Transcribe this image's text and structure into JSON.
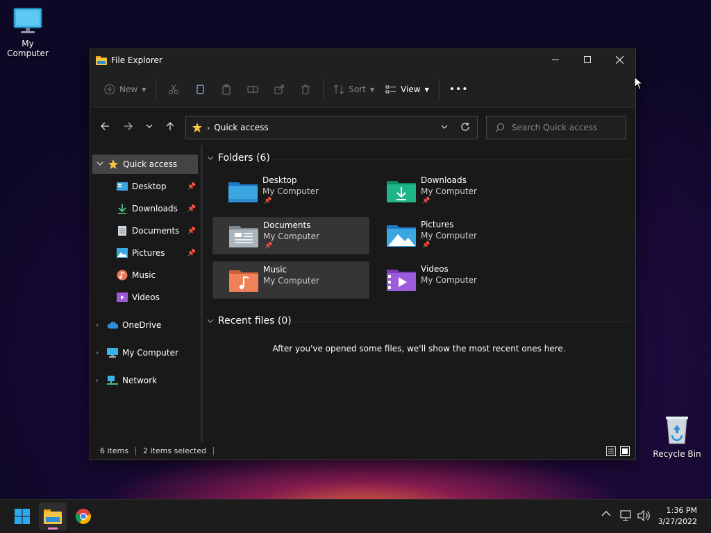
{
  "desktop": {
    "my_computer": "My Computer",
    "recycle_bin": "Recycle Bin"
  },
  "window": {
    "title": "File Explorer",
    "toolbar": {
      "new_label": "New",
      "sort_label": "Sort",
      "view_label": "View",
      "more_label": "•••"
    },
    "address": {
      "location": "Quick access"
    },
    "search": {
      "placeholder": "Search Quick access"
    },
    "sidebar": {
      "quick_access": "Quick access",
      "items": [
        {
          "label": "Desktop"
        },
        {
          "label": "Downloads"
        },
        {
          "label": "Documents"
        },
        {
          "label": "Pictures"
        },
        {
          "label": "Music"
        },
        {
          "label": "Videos"
        }
      ],
      "onedrive": "OneDrive",
      "my_computer": "My Computer",
      "network": "Network"
    },
    "content": {
      "folders_header": "Folders (6)",
      "folders": [
        {
          "name": "Desktop",
          "location": "My Computer",
          "pinned": true
        },
        {
          "name": "Downloads",
          "location": "My Computer",
          "pinned": true
        },
        {
          "name": "Documents",
          "location": "My Computer",
          "pinned": true
        },
        {
          "name": "Pictures",
          "location": "My Computer",
          "pinned": true
        },
        {
          "name": "Music",
          "location": "My Computer",
          "pinned": false
        },
        {
          "name": "Videos",
          "location": "My Computer",
          "pinned": false
        }
      ],
      "recent_header": "Recent files (0)",
      "recent_message": "After you've opened some files, we'll show the most recent ones here."
    },
    "status": {
      "items": "6 items",
      "selected": "2 items selected"
    }
  },
  "taskbar": {
    "time": "1:36 PM",
    "date": "3/27/2022"
  },
  "colors": {
    "accent": "#0078d4",
    "folder_yellow": "#f4c542",
    "window_bg": "#191919"
  }
}
